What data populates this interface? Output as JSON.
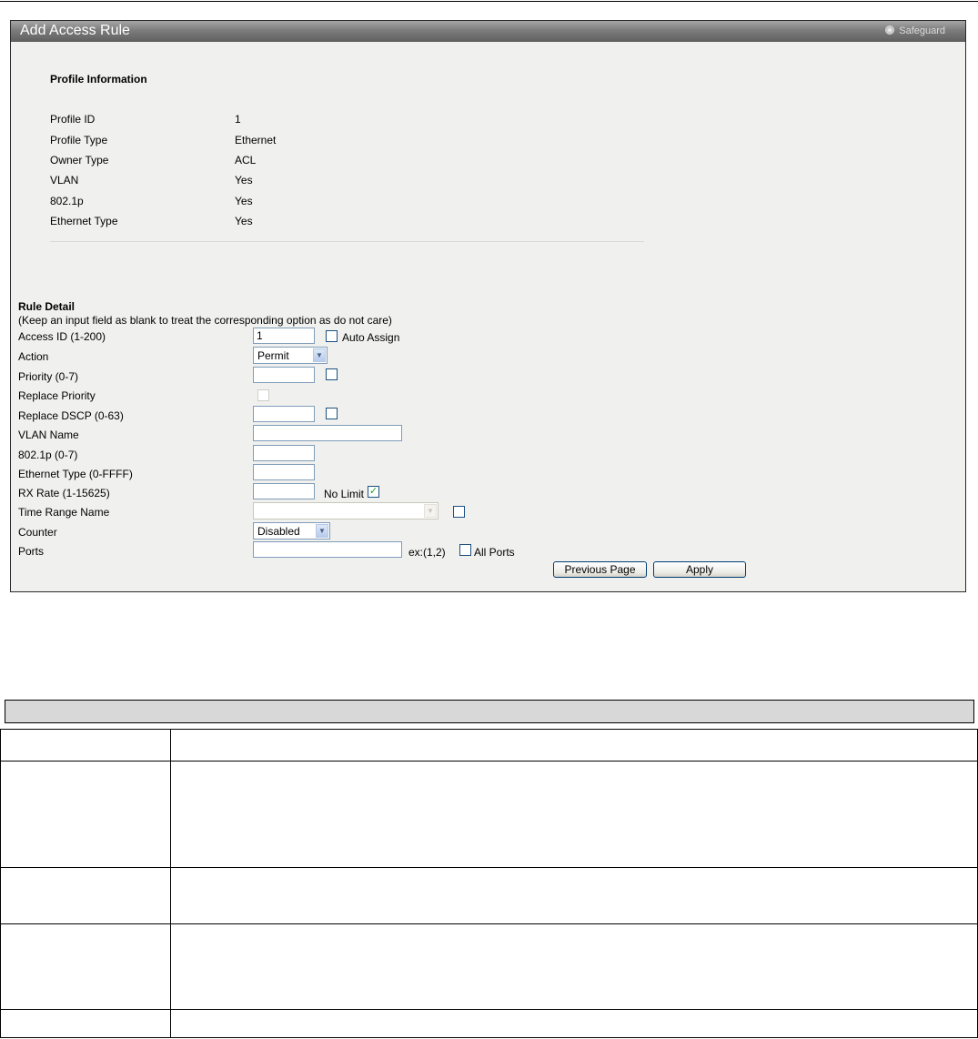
{
  "panel": {
    "title": "Add Access Rule",
    "safeguard": "Safeguard"
  },
  "profile": {
    "heading": "Profile Information",
    "rows": [
      {
        "label": "Profile ID",
        "value": "1"
      },
      {
        "label": "Profile Type",
        "value": "Ethernet"
      },
      {
        "label": "Owner Type",
        "value": "ACL"
      },
      {
        "label": "VLAN",
        "value": "Yes"
      },
      {
        "label": "802.1p",
        "value": "Yes"
      },
      {
        "label": "Ethernet Type",
        "value": "Yes"
      }
    ]
  },
  "rule": {
    "heading": "Rule Detail",
    "note": "(Keep an input field as blank to treat the corresponding option as do not care)",
    "access_id": {
      "label": "Access ID (1-200)",
      "value": "1",
      "auto_assign_label": "Auto Assign",
      "auto_assign_checked": false
    },
    "action": {
      "label": "Action",
      "value": "Permit"
    },
    "priority": {
      "label": "Priority (0-7)",
      "value": "",
      "checked": false
    },
    "replace_priority": {
      "label": "Replace Priority",
      "checked": false,
      "disabled": true
    },
    "replace_dscp": {
      "label": "Replace DSCP (0-63)",
      "value": "",
      "checked": false
    },
    "vlan_name": {
      "label": "VLAN Name",
      "value": ""
    },
    "dot1p": {
      "label": "802.1p (0-7)",
      "value": ""
    },
    "ethernet_type": {
      "label": "Ethernet Type (0-FFFF)",
      "value": ""
    },
    "rx_rate": {
      "label": "RX Rate (1-15625)",
      "value": "",
      "no_limit_label": "No Limit",
      "no_limit_checked": true
    },
    "time_range": {
      "label": "Time Range Name",
      "value": "",
      "checked": false,
      "disabled": true
    },
    "counter": {
      "label": "Counter",
      "value": "Disabled"
    },
    "ports": {
      "label": "Ports",
      "value": "",
      "hint": "ex:(1,2)",
      "all_ports_label": "All Ports",
      "all_ports_checked": false
    }
  },
  "buttons": {
    "previous": "Previous Page",
    "apply": "Apply"
  },
  "icons": {
    "safeguard": "status-dot-icon",
    "dropdown": "chevron-down-icon",
    "check": "check-icon"
  },
  "description_table": {
    "header": "",
    "rows": [
      {
        "param": "",
        "description": ""
      },
      {
        "param": "",
        "description": ""
      },
      {
        "param": "",
        "description": ""
      },
      {
        "param": "",
        "description": ""
      },
      {
        "param": "",
        "description": ""
      }
    ]
  }
}
